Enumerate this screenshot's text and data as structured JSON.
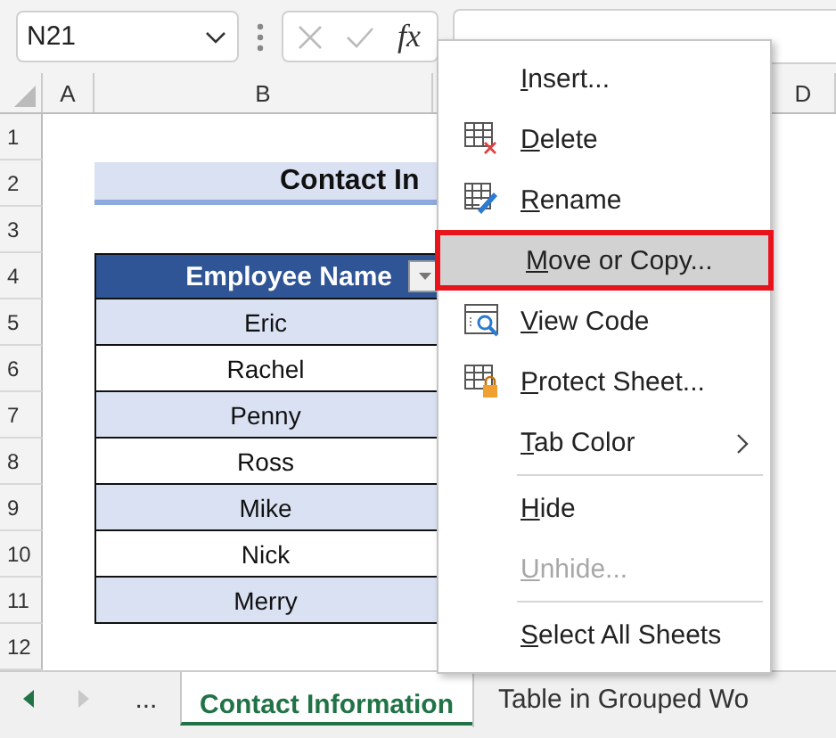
{
  "formula_bar": {
    "name_box": "N21",
    "function_label": "fx"
  },
  "columns": [
    {
      "label": "A",
      "kind": "narrow"
    },
    {
      "label": "B",
      "kind": "wide"
    },
    {
      "kind": "wide"
    },
    {
      "label": "D",
      "kind": "rest"
    }
  ],
  "row_numbers": [
    "1",
    "2",
    "3",
    "4",
    "5",
    "6",
    "7",
    "8",
    "9",
    "10",
    "11",
    "12"
  ],
  "title": "Contact In",
  "table": {
    "header": "Employee Name",
    "rows": [
      "Eric",
      "Rachel",
      "Penny",
      "Ross",
      "Mike",
      "Nick",
      "Merry"
    ]
  },
  "context_menu": {
    "items": [
      {
        "kind": "plain",
        "label": "Insert...",
        "selected": false,
        "disabled": false,
        "highlighted": false,
        "submenu": false
      },
      {
        "kind": "delete",
        "label": "Delete",
        "selected": false,
        "disabled": false,
        "highlighted": false,
        "submenu": false
      },
      {
        "kind": "rename",
        "label": "Rename",
        "selected": false,
        "disabled": false,
        "highlighted": false,
        "submenu": false
      },
      {
        "kind": "plain",
        "label": "Move or Copy...",
        "selected": true,
        "disabled": false,
        "highlighted": true,
        "submenu": false
      },
      {
        "kind": "viewcode",
        "label": "View Code",
        "selected": false,
        "disabled": false,
        "highlighted": false,
        "submenu": false
      },
      {
        "kind": "protect",
        "label": "Protect Sheet...",
        "selected": false,
        "disabled": false,
        "highlighted": false,
        "submenu": false
      },
      {
        "kind": "plain",
        "label": "Tab Color",
        "selected": false,
        "disabled": false,
        "highlighted": false,
        "submenu": true
      },
      {
        "kind": "separator"
      },
      {
        "kind": "plain",
        "label": "Hide",
        "selected": false,
        "disabled": false,
        "highlighted": false,
        "submenu": false
      },
      {
        "kind": "plain",
        "label": "Unhide...",
        "selected": false,
        "disabled": true,
        "highlighted": false,
        "submenu": false
      },
      {
        "kind": "separator"
      },
      {
        "kind": "plain",
        "label": "Select All Sheets",
        "selected": false,
        "disabled": false,
        "highlighted": false,
        "submenu": false
      }
    ]
  },
  "sheet_tabs": {
    "more": "...",
    "tabs": [
      {
        "label": "Contact Information",
        "selected": true
      },
      {
        "label": "Table in Grouped Wo",
        "selected": false
      }
    ]
  }
}
